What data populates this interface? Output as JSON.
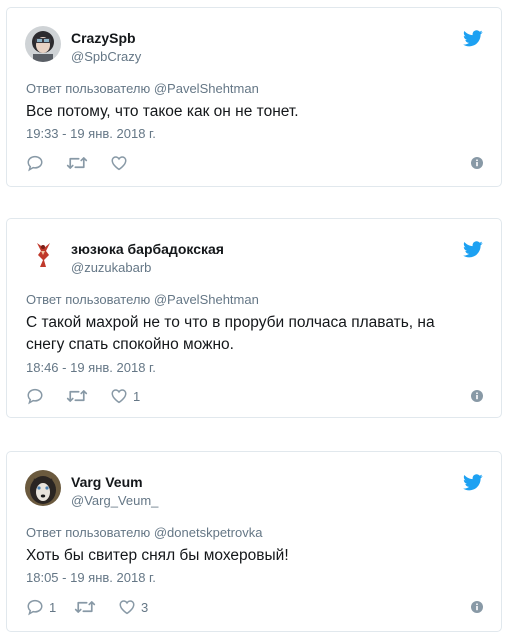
{
  "reply_prefix": "Ответ пользователю",
  "colors": {
    "twitter_blue": "#1da1f2",
    "icon_gray": "#8899a6",
    "text_dark": "#14171a",
    "text_gray": "#657786",
    "border": "#e1e8ed"
  },
  "icons": {
    "logo": "twitter-bird-icon",
    "reply": "reply-bubble-icon",
    "retweet": "retweet-arrows-icon",
    "like": "heart-icon",
    "info": "info-circle-icon"
  },
  "tweets": [
    {
      "name": "CrazySpb",
      "handle": "@SpbCrazy",
      "reply_to": "@PavelShehtman",
      "text": "Все потому, что такое как он не тонет.",
      "timestamp": "19:33 - 19 янв. 2018 г.",
      "reply_count": "",
      "retweet_count": "",
      "like_count": ""
    },
    {
      "name": "зюзюка барбадокская",
      "handle": "@zuzukabarb",
      "reply_to": "@PavelShehtman",
      "text": "С такой махрой не то что в проруби полчаса плавать, на снегу спать спокойно можно.",
      "timestamp": "18:46 - 19 янв. 2018 г.",
      "reply_count": "",
      "retweet_count": "",
      "like_count": "1"
    },
    {
      "name": "Varg Veum",
      "handle": "@Varg_Veum_",
      "reply_to": "@donetskpetrovka",
      "text": "Хоть бы свитер снял бы мохеровый!",
      "timestamp": "18:05 - 19 янв. 2018 г.",
      "reply_count": "1",
      "retweet_count": "",
      "like_count": "3"
    }
  ]
}
